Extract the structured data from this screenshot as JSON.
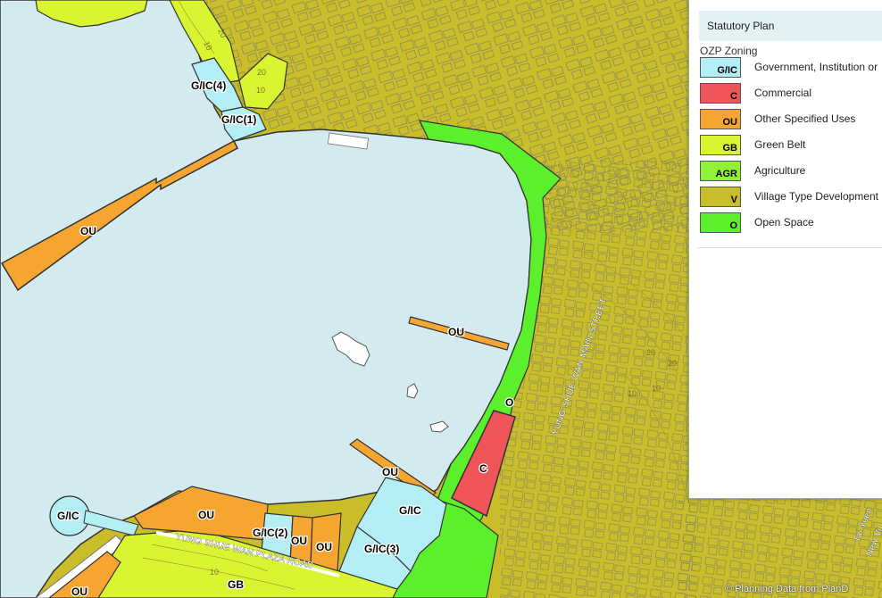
{
  "legend": {
    "title": "Statutory Plan",
    "subtitle": "OZP Zoning",
    "items": [
      {
        "code": "G/IC",
        "label": "Government, Institution or",
        "color": "#b3eef5"
      },
      {
        "code": "C",
        "label": "Commercial",
        "color": "#ef5459"
      },
      {
        "code": "OU",
        "label": "Other Specified Uses",
        "color": "#f7a531"
      },
      {
        "code": "GB",
        "label": "Green Belt",
        "color": "#d9f531"
      },
      {
        "code": "AGR",
        "label": "Agriculture",
        "color": "#8ff238"
      },
      {
        "code": "V",
        "label": "Village Type Development",
        "color": "#c9bd2a"
      },
      {
        "code": "O",
        "label": "Open Space",
        "color": "#5cf02c"
      }
    ]
  },
  "map": {
    "zone_labels": {
      "gic4": "G/IC(4)",
      "gic1": "G/IC(1)",
      "ou_pier": "OU",
      "ou_jetty": "OU",
      "o_strip": "O",
      "c_site": "C",
      "ou_small": "OU",
      "gic_roundabout": "G/IC",
      "ou_left": "OU",
      "gic2": "G/IC(2)",
      "ou_mid1": "OU",
      "ou_mid2": "OU",
      "gic3": "G/IC(3)",
      "gic_right": "G/IC",
      "gb_bottom": "GB",
      "ou_bottom": "OU"
    },
    "streets": {
      "main_street": "YUNG SHUE WAN MAIN STREET",
      "plaza_road": "YUNG SHUE WAN PLAZA ROAD",
      "tai_yuen": "Tai Yuen",
      "new_village": "New Vil"
    },
    "contours": [
      "10",
      "20",
      "20",
      "10",
      "20",
      "10",
      "10",
      "20",
      "10"
    ]
  },
  "credit": "© Planning Data from PlanD"
}
